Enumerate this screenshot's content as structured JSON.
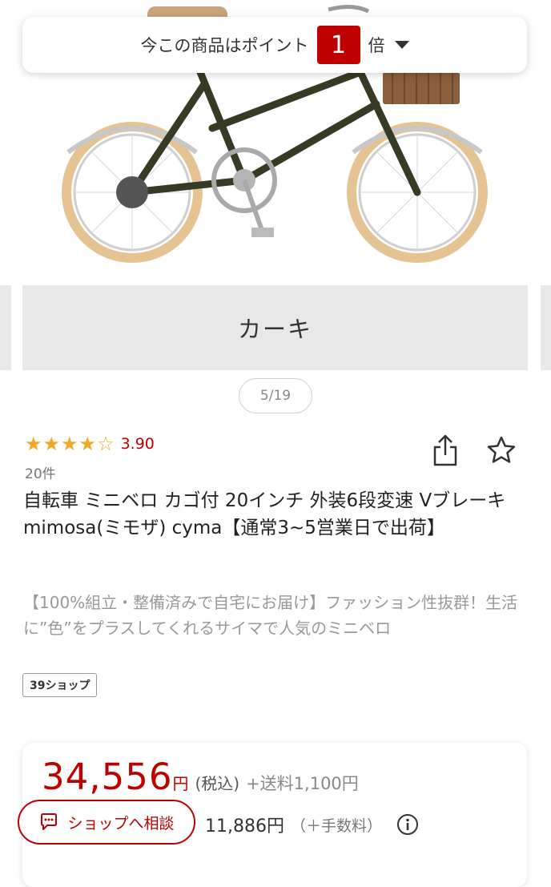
{
  "point_banner": {
    "prefix": "今この商品はポイント",
    "multiplier": "1",
    "suffix": "倍"
  },
  "gallery": {
    "variant_label": "カーキ",
    "counter": "5/19"
  },
  "rating": {
    "score": "3.90",
    "stars_value": 4,
    "stars_max": 5,
    "review_count": "20件"
  },
  "product": {
    "title": "自転車 ミニベロ カゴ付 20インチ 外装6段変速 Vブレーキ mimosa(ミモザ) cyma【通常3~5営業日で出荷】",
    "description": "【100%組立・整備済みで自宅にお届け】ファッション性抜群！生活に”色”をプラスしてくれるサイマで人気のミニベロ",
    "shop_tag": "39ショップ"
  },
  "price": {
    "amount": "34,556",
    "currency": "円",
    "tax_label": "(税込)",
    "shipping": "+送料1,100円",
    "sub_amount": "11,886円",
    "fee_label": "（＋手数料）"
  },
  "consult_button": {
    "label": "ショップへ相談"
  },
  "colors": {
    "accent": "#bf0000",
    "star": "#f5a623",
    "bike_frame": "#353b24",
    "tire": "#e6c392"
  },
  "icons": [
    "caret-down-icon",
    "star-icon",
    "share-icon",
    "favorite-star-icon",
    "info-icon",
    "chat-icon"
  ]
}
